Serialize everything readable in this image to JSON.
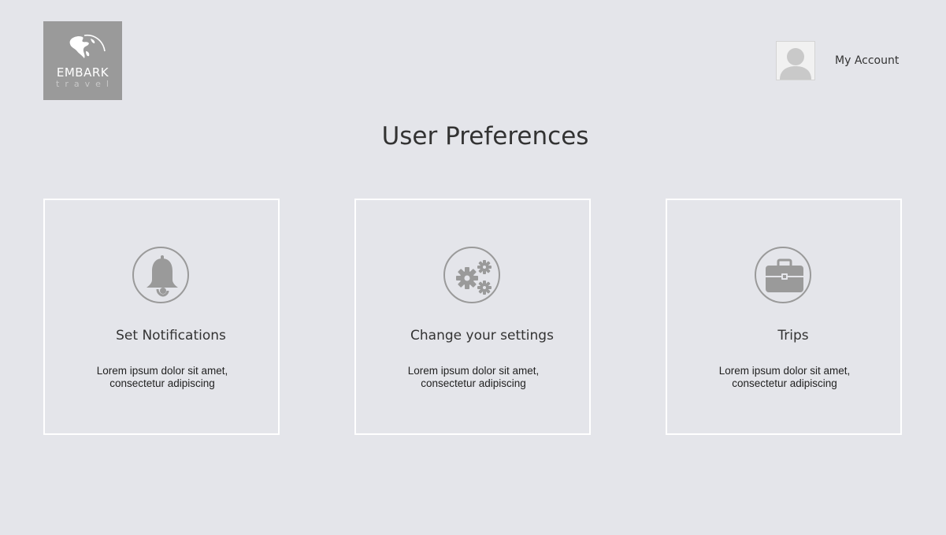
{
  "header": {
    "logo": {
      "brand": "EMBARK",
      "tagline": "travel",
      "icon": "globe-icon"
    },
    "account": {
      "avatar_icon": "user-avatar-icon",
      "label": "My Account"
    }
  },
  "page": {
    "title": "User Preferences"
  },
  "cards": [
    {
      "icon": "bell-icon",
      "title": "Set Notifications",
      "text": "Lorem ipsum dolor sit amet, consectetur adipiscing"
    },
    {
      "icon": "gears-icon",
      "title": "Change your settings",
      "text": "Lorem ipsum dolor sit amet, consectetur adipiscing"
    },
    {
      "icon": "briefcase-icon",
      "title": "Trips",
      "text": "Lorem ipsum dolor sit amet, consectetur adipiscing"
    }
  ],
  "colors": {
    "background": "#e4e5ea",
    "logo_background": "#9a9a9a",
    "icon_gray": "#9a9a9a",
    "card_border": "#ffffff",
    "text": "#333333"
  }
}
